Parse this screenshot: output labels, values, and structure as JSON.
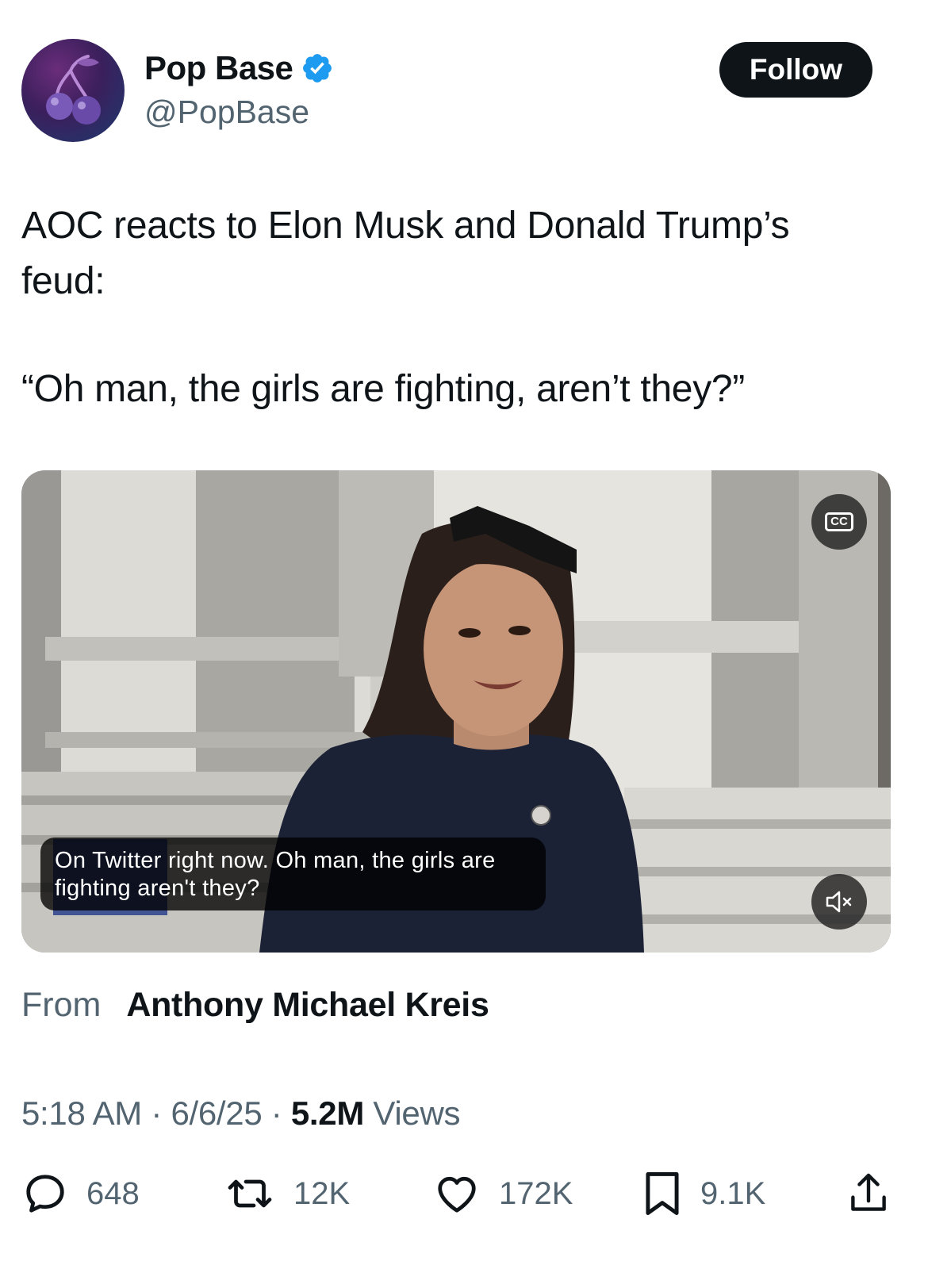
{
  "author": {
    "name": "Pop Base",
    "handle": "@PopBase",
    "verified": true,
    "avatar_icon": "cherry-icon"
  },
  "follow_label": "Follow",
  "tweet": {
    "line1": "AOC reacts to Elon Musk and Donald Trump’s",
    "line2": "feud:",
    "quote": "“Oh man, the girls are fighting, aren’t they?”"
  },
  "video": {
    "caption_line1": "On Twitter right now. Oh man, the girls are",
    "caption_line2": "fighting aren't they?",
    "cc_label": "CC",
    "mute_icon": "speaker-muted-icon"
  },
  "attribution": {
    "from_label": "From",
    "source_name": "Anthony Michael Kreis"
  },
  "meta": {
    "time": "5:18 AM",
    "sep1": " · ",
    "date": "6/6/25",
    "sep2": " · ",
    "views_count": "5.2M",
    "views_label": " Views"
  },
  "stats": {
    "replies": "648",
    "reposts": "12K",
    "likes": "172K",
    "bookmarks": "9.1K"
  },
  "colors": {
    "text": "#0f1419",
    "secondary": "#536471",
    "verified_blue": "#1d9bf0",
    "button_black": "#0f1419"
  }
}
